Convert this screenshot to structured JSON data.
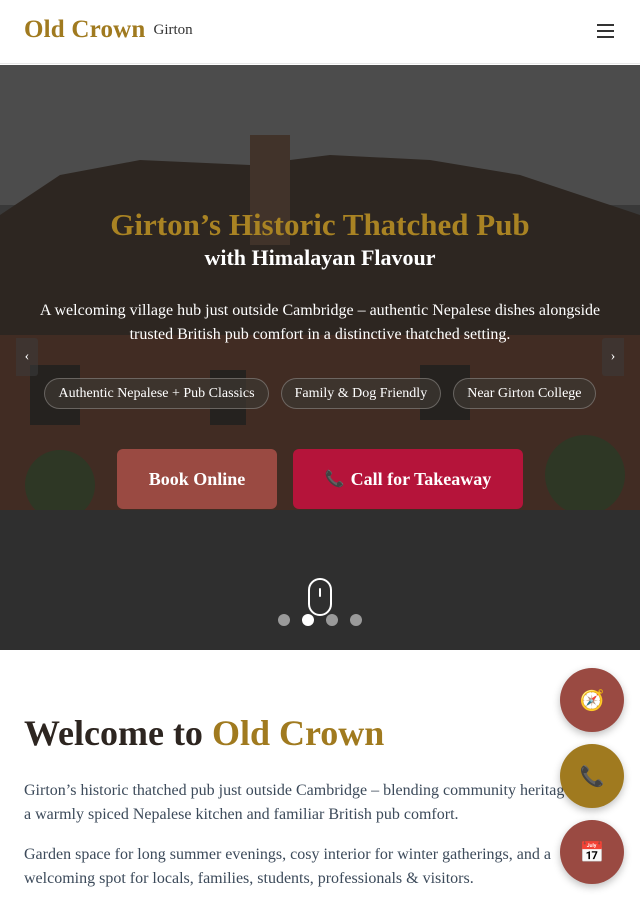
{
  "header": {
    "brand_name": "Old Crown",
    "brand_location": "Girton"
  },
  "hero": {
    "title": "Girton’s Historic Thatched Pub",
    "subtitle": "with Himalayan Flavour",
    "description": "A welcoming village hub just outside Cambridge – authentic Nepalese dishes alongside trusted British pub comfort in a distinctive thatched setting.",
    "prev_glyph": "‹",
    "next_glyph": "›",
    "pills": [
      {
        "label": "Authentic Nepalese + Pub Classics"
      },
      {
        "label": "Family & Dog Friendly"
      },
      {
        "label": "Near Girton College"
      }
    ],
    "book_label": "Book Online",
    "call_label": "Call for Takeaway",
    "call_icon": "📞",
    "slides_total": 4,
    "active_slide": 2
  },
  "welcome": {
    "title_prefix": "Welcome to",
    "title_accent": "Old Crown",
    "paragraph_1": "Girton’s historic thatched pub just outside Cambridge – blending community heritage, a warmly spiced Nepalese kitchen and familiar British pub comfort.",
    "paragraph_2": "Garden space for long summer evenings, cosy interior for winter gatherings, and a welcoming spot for locals, families, students, professionals & visitors."
  },
  "fabs": {
    "directions_icon": "🧭",
    "phone_icon": "📞",
    "calendar_icon": "📅"
  },
  "colors": {
    "brand_gold": "#a07a1f",
    "book_button": "#9a4a42",
    "call_button": "#b5143a"
  }
}
